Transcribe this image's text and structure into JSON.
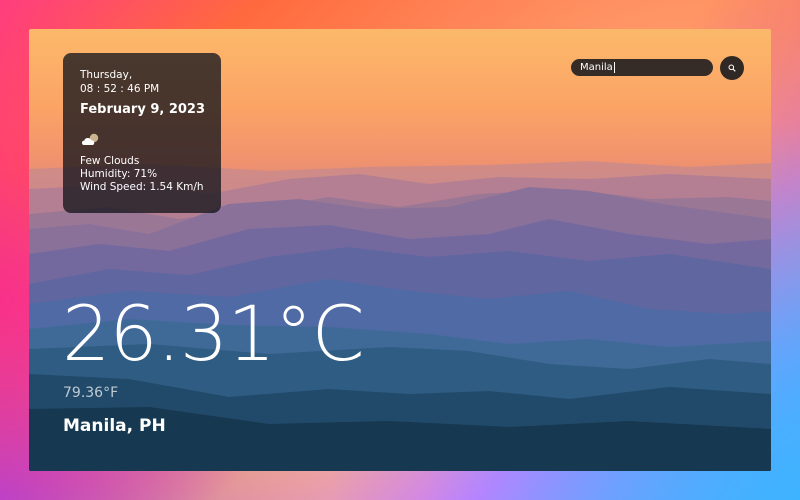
{
  "datetime": {
    "day": "Thursday,",
    "time": "08 : 52 : 46 PM",
    "date": "February 9, 2023"
  },
  "weather": {
    "icon": "few-clouds-icon",
    "condition": "Few Clouds",
    "humidity": "Humidity: 71%",
    "wind_speed": "Wind Speed: 1.54 Km/h"
  },
  "search": {
    "value": "Manila",
    "button_icon": "search-icon"
  },
  "temperature": {
    "celsius": "26.31°C",
    "fahrenheit": "79.36°F"
  },
  "location": "Manila, PH",
  "colors": {
    "card_bg": "#16161c",
    "text": "#ffffff"
  }
}
